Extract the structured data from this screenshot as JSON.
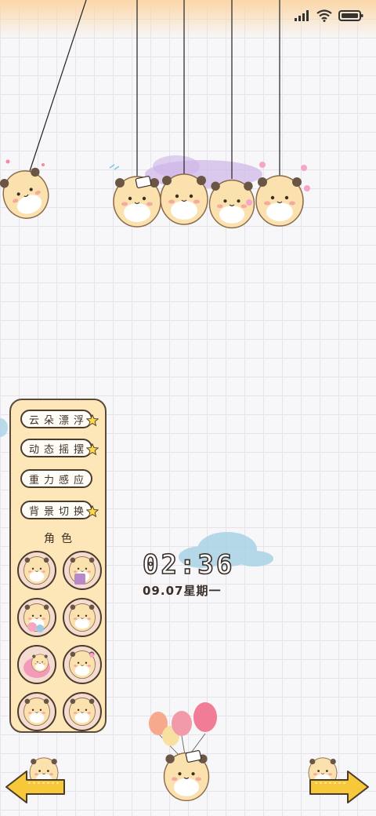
{
  "status_bar": {
    "signal_icon": "cellular-signal-icon",
    "wifi_icon": "wifi-icon",
    "battery_icon": "battery-icon"
  },
  "menu": {
    "items": [
      {
        "label": "云朵漂浮",
        "starred": true
      },
      {
        "label": "动态摇摆",
        "starred": true
      },
      {
        "label": "重力感应",
        "starred": false
      },
      {
        "label": "背景切换",
        "starred": true
      }
    ],
    "role_title": "角色",
    "avatars": [
      "hamster-avatar-1",
      "hamster-boba-avatar",
      "hamster-balloon-avatar",
      "hamster-avatar-4",
      "hamster-pink-blanket-avatar",
      "hamster-flower-avatar",
      "hamster-avatar-7",
      "hamster-avatar-8"
    ]
  },
  "clock": {
    "time": "02:36",
    "date": "09.07星期一"
  },
  "nav": {
    "left_arrow_icon": "yellow-arrow-left-icon",
    "right_arrow_icon": "yellow-arrow-right-icon"
  },
  "colors": {
    "panel_bg": "#fde6b8",
    "outline": "#4b3b2d",
    "hamster_body": "#fbe1ad",
    "arrow_yellow": "#f7c93a",
    "cloud_blue": "#a9d3e6",
    "cloud_purple": "#cdb5e8"
  }
}
